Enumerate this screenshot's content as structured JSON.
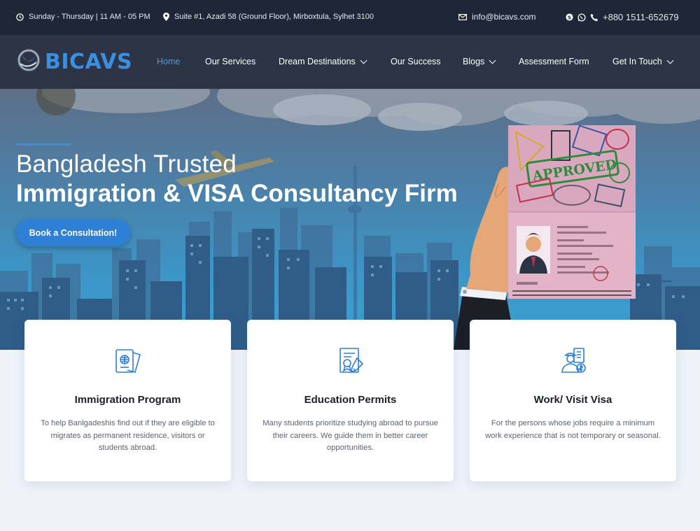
{
  "topbar": {
    "hours": "Sunday - Thursday | 11 AM - 05 PM",
    "address": "Suite #1, Azadi 58 (Ground Floor), Mirboxtula, Sylhet 3100",
    "email": "info@bicavs.com",
    "phone": "+880 1511-652679"
  },
  "header": {
    "logo_text": "BICAVS",
    "nav": [
      {
        "label": "Home",
        "active": true
      },
      {
        "label": "Our Services"
      },
      {
        "label": "Dream Destinations",
        "dropdown": true
      },
      {
        "label": "Our Success"
      },
      {
        "label": "Blogs",
        "dropdown": true
      },
      {
        "label": "Assessment Form"
      },
      {
        "label": "Get In Touch",
        "dropdown": true
      }
    ]
  },
  "hero": {
    "line1": "Bangladesh Trusted",
    "line2": "Immigration & VISA Consultancy Firm",
    "cta_label": "Book a Consultation!",
    "stamp_text": "APPROVED"
  },
  "cards": [
    {
      "icon": "passport-icon",
      "title": "Immigration Program",
      "text": "To help Banlgadeshis find out if they are eligible to migrates as permanent residence, visitors or students abroad."
    },
    {
      "icon": "certificate-icon",
      "title": "Education Permits",
      "text": "Many students prioritize studying abroad to pursue their careers. We guide them in better career opportunities."
    },
    {
      "icon": "worker-icon",
      "title": "Work/ Visit Visa",
      "text": "For the persons whose jobs require a minimum work experience that is not temporary or seasonal."
    }
  ],
  "colors": {
    "accent": "#2e7fd6",
    "topbar": "#1e2638",
    "header": "#232c3e"
  }
}
